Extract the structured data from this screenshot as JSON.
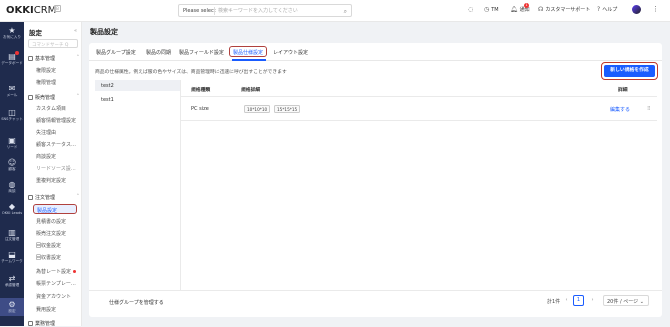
{
  "topbar": {
    "logo_main": "OKKI",
    "logo_sub": "CRM",
    "logo_badge": "B",
    "search_select": "Please select",
    "search_placeholder": "検索キーワードを入力してください",
    "items": [
      {
        "icon": "lamp-icon",
        "label": ""
      },
      {
        "icon": "clock-icon",
        "label": "TM"
      },
      {
        "icon": "bell-icon",
        "label": "通知",
        "badge": "1"
      },
      {
        "icon": "headset-icon",
        "label": "カスタマーサポート"
      },
      {
        "icon": "help-icon",
        "label": "ヘルプ"
      }
    ]
  },
  "rail": [
    {
      "icon": "star-icon",
      "label": "お気に入り"
    },
    {
      "icon": "chart-icon",
      "label": "データボード"
    },
    {
      "icon": "mail-icon",
      "label": "メール"
    },
    {
      "icon": "chat-icon",
      "label": "SNSチャット"
    },
    {
      "icon": "lead-icon",
      "label": "リード"
    },
    {
      "icon": "customer-icon",
      "label": "顧客"
    },
    {
      "icon": "globe-icon",
      "label": "商談"
    },
    {
      "icon": "ai-icon",
      "label": "OKKI Leads"
    },
    {
      "icon": "order-icon",
      "label": "注文管理"
    },
    {
      "icon": "team-icon",
      "label": "チームワーク"
    },
    {
      "icon": "approval-icon",
      "label": "承認管理"
    },
    {
      "icon": "settings-icon",
      "label": "設定"
    }
  ],
  "subnav": {
    "title": "設定",
    "search_placeholder": "コマンドサーチ Q",
    "groups": [
      {
        "label": "基本管理",
        "items": [
          "権限設定",
          "権限管理"
        ]
      },
      {
        "label": "販売管理",
        "items": [
          "カスタム項目",
          "顧客情報管理設定",
          "失注理由",
          "顧客ステータス…",
          "商談設定",
          "リードソース設…",
          "重複判定設定"
        ]
      },
      {
        "label": "注文管理",
        "items": [
          "製品設定",
          "見積書の設定",
          "販売注文設定",
          "回収金設定",
          "回収書設定",
          "為替レート設定",
          "帳票テンプレー…",
          "資金アカウント",
          "費用設定"
        ]
      },
      {
        "label": "業務管理",
        "items": []
      }
    ]
  },
  "page": {
    "title": "製品設定",
    "tabs": [
      "製品グループ設定",
      "製品の同期",
      "製品フィールド設定",
      "製品仕様設定",
      "レイアウト設定"
    ],
    "active_tab": 3,
    "description": "商品の仕様属性。例えば服の色やサイズは、商品管理時に迅速に呼び出すことができます",
    "create_button": "新しい規格を作成",
    "left_list": [
      "test2",
      "test1"
    ],
    "table": {
      "headers": [
        "規格種類",
        "規格詳細",
        "詳細"
      ],
      "rows": [
        {
          "name": "PC size",
          "tags": [
            "10*10*10",
            "15*15*15"
          ],
          "action": "編集する"
        }
      ]
    },
    "manage_link": "仕様グループを管理する",
    "pagination": {
      "total": "計1件",
      "current": "1",
      "page_size": "20件 / ページ"
    }
  }
}
